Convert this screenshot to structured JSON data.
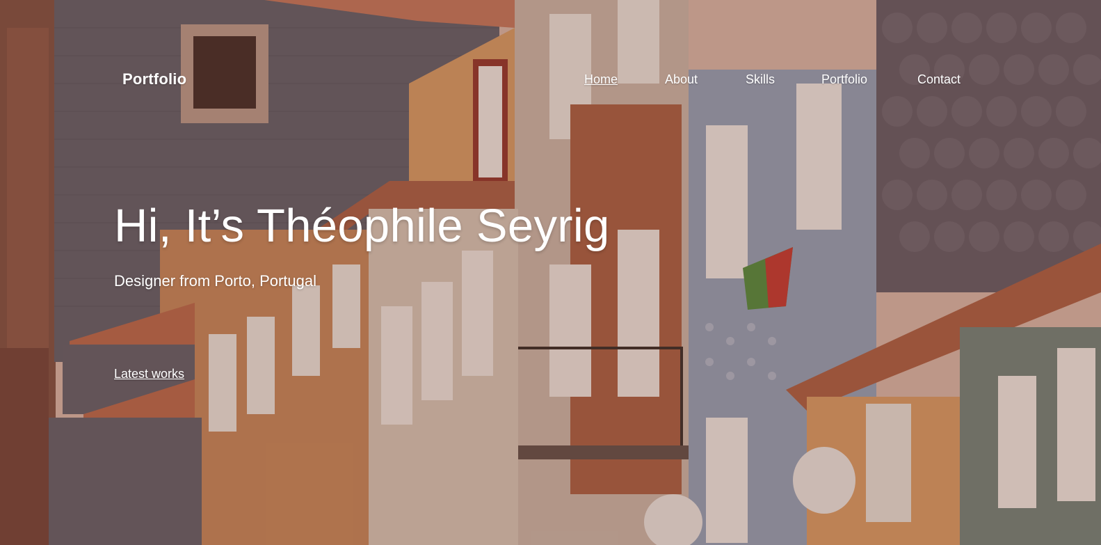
{
  "brand": {
    "logo_text": "Portfolio"
  },
  "nav": {
    "items": [
      {
        "label": "Home",
        "active": true
      },
      {
        "label": "About",
        "active": false
      },
      {
        "label": "Skills",
        "active": false
      },
      {
        "label": "Portfolio",
        "active": false
      },
      {
        "label": "Contact",
        "active": false
      }
    ]
  },
  "hero": {
    "headline": "Hi, It’s Théophile Seyrig",
    "subtitle": "Designer from Porto, Portugal",
    "cta_label": "Latest works",
    "background_image": "street-facades-photo",
    "overlay_color": "#784637"
  },
  "colors": {
    "text": "#ffffff"
  }
}
